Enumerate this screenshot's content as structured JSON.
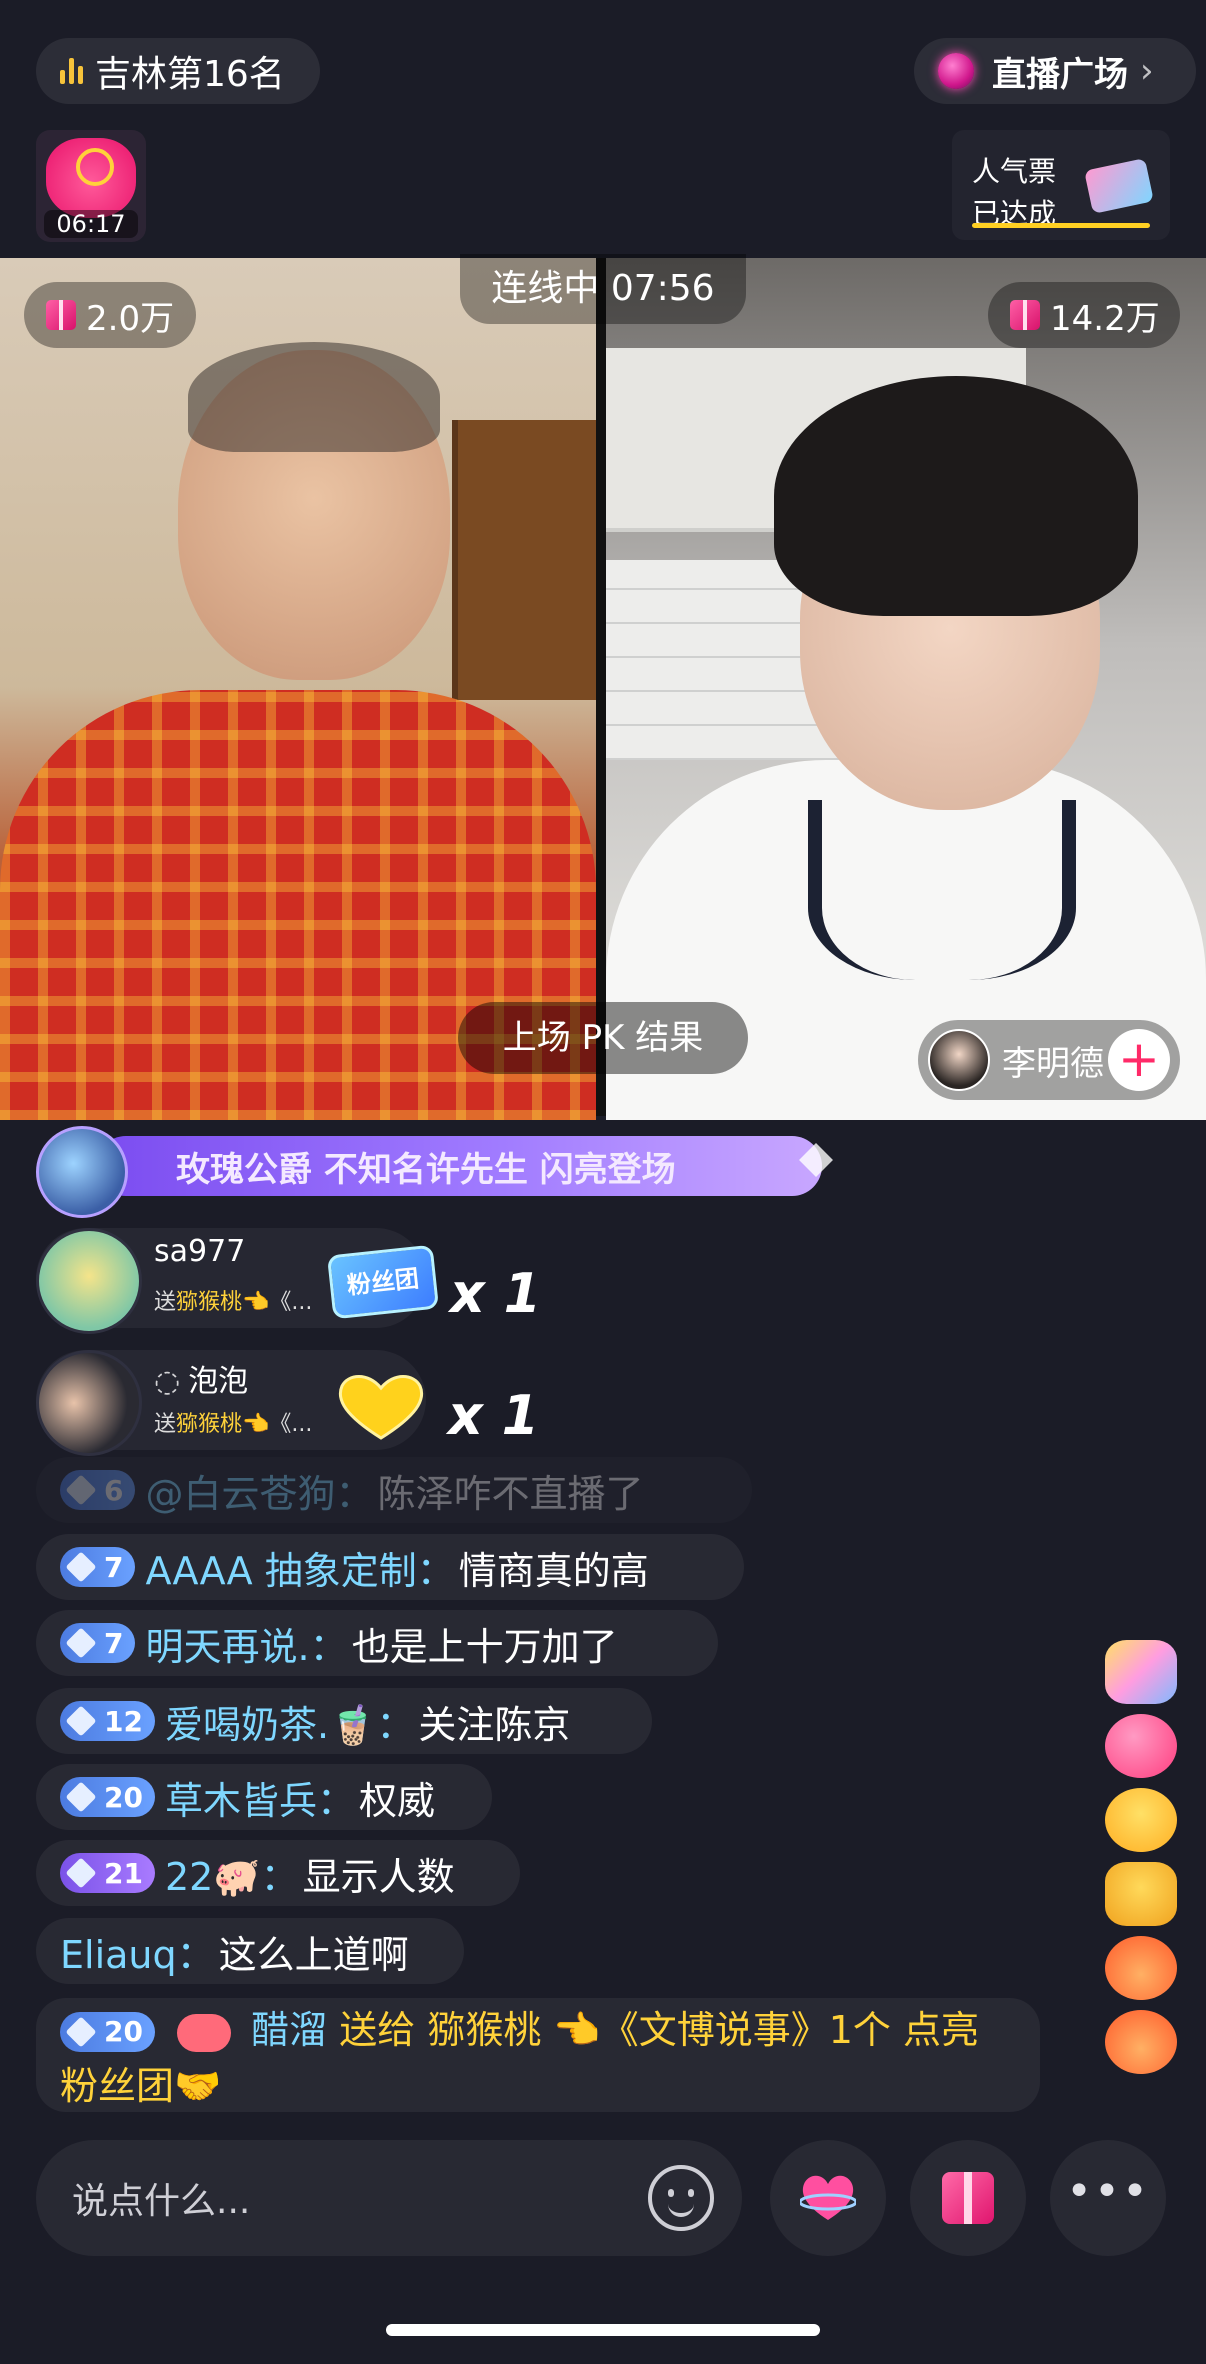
{
  "top": {
    "rank_label": "吉林第16名",
    "plaza_label": "直播广场",
    "plaza_chevron": "›",
    "redpack_timer": "06:17",
    "popular_line1": "人气票",
    "popular_line2": "已达成"
  },
  "video": {
    "left_gift_count": "2.0万",
    "right_gift_count": "14.2万",
    "link_timer": "连线中 07:56",
    "pk_result": "上场 PK 结果",
    "peer_name": "李明德",
    "peer_plus": "+"
  },
  "welcome": {
    "text": "玫瑰公爵   不知名许先生  闪亮登场"
  },
  "gifts": [
    {
      "name": "sa977",
      "sent_prefix": "送",
      "item": "猕猴桃",
      "tail": "👈《...",
      "count": "x 1"
    },
    {
      "name": "泡泡",
      "sent_prefix": "送",
      "item": "猕猴桃",
      "tail": "👈《...",
      "count": "x 1"
    }
  ],
  "fan_badge": "粉丝团",
  "chat": [
    {
      "level": "6",
      "user": "@白云苍狗：",
      "text": "陈泽咋不直播了"
    },
    {
      "level": "7",
      "user": "AAAA 抽象定制：",
      "text": "情商真的高"
    },
    {
      "level": "7",
      "user": "明天再说.：",
      "text": "也是上十万加了"
    },
    {
      "level": "12",
      "user": "爱喝奶茶.🧋：",
      "text": "关注陈京"
    },
    {
      "level": "20",
      "user": "草木皆兵：",
      "text": "权威"
    },
    {
      "level": "21",
      "user": "22🐖：",
      "text": "显示人数"
    },
    {
      "level": "",
      "user": "Eliauq：",
      "text": "这么上道啊"
    }
  ],
  "big_message": {
    "level": "20",
    "user": "醋溜",
    "line1_rest": " 送给 猕猴桃 👈《文博说事》1个 点亮",
    "line2": "粉丝团🤝"
  },
  "input": {
    "placeholder": "说点什么..."
  },
  "more_label": "•••"
}
